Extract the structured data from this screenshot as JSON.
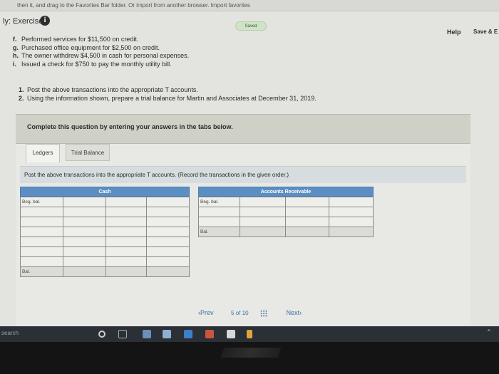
{
  "browser": {
    "favorites_bar_text": "then it, and drag to the Favorites Bar folder. Or import from another browser. Import favorites"
  },
  "header": {
    "title": "ly: Exercise",
    "saved_label": "Saved",
    "help_label": "Help",
    "save_label": "Save & E"
  },
  "transactions": [
    {
      "letter": "f.",
      "text": "Performed services for $11,500 on credit."
    },
    {
      "letter": "g.",
      "text": "Purchased office equipment for $2,500 on credit."
    },
    {
      "letter": "h.",
      "text": "The owner withdrew $4,500 in cash for personal expenses."
    },
    {
      "letter": "i.",
      "text": "Issued a check for $750 to pay the monthly utility bill."
    }
  ],
  "instructions": [
    {
      "num": "1.",
      "text": "Post the above transactions into the appropriate T accounts."
    },
    {
      "num": "2.",
      "text": "Using the information shown, prepare a trial balance for Martin and Associates at December 31, 2019."
    }
  ],
  "complete_prompt": "Complete this question by entering your answers in the tabs below.",
  "tabs": [
    {
      "label": "Ledgers",
      "active": true
    },
    {
      "label": "Trial Balance",
      "active": false
    }
  ],
  "post_prompt": "Post the above transactions into the appropriate T accounts. (Record the transactions in the given order.)",
  "ledgers": {
    "cash": {
      "title": "Cash",
      "beg_bal_label": "Beg. bal.",
      "bal_label": "Bal."
    },
    "accounts_receivable": {
      "title": "Accounts Receivable",
      "beg_bal_label": "Beg. bal.",
      "bal_label": "Bal."
    }
  },
  "pager": {
    "prev_label": "Prev",
    "current": "5",
    "of_label": "of",
    "total": "10",
    "next_label": "Next"
  },
  "taskbar": {
    "search_label": "search"
  },
  "colors": {
    "ledger_header": "#5b8fc4",
    "link": "#3a6fa9",
    "saved_badge": "#cfe3c6"
  }
}
